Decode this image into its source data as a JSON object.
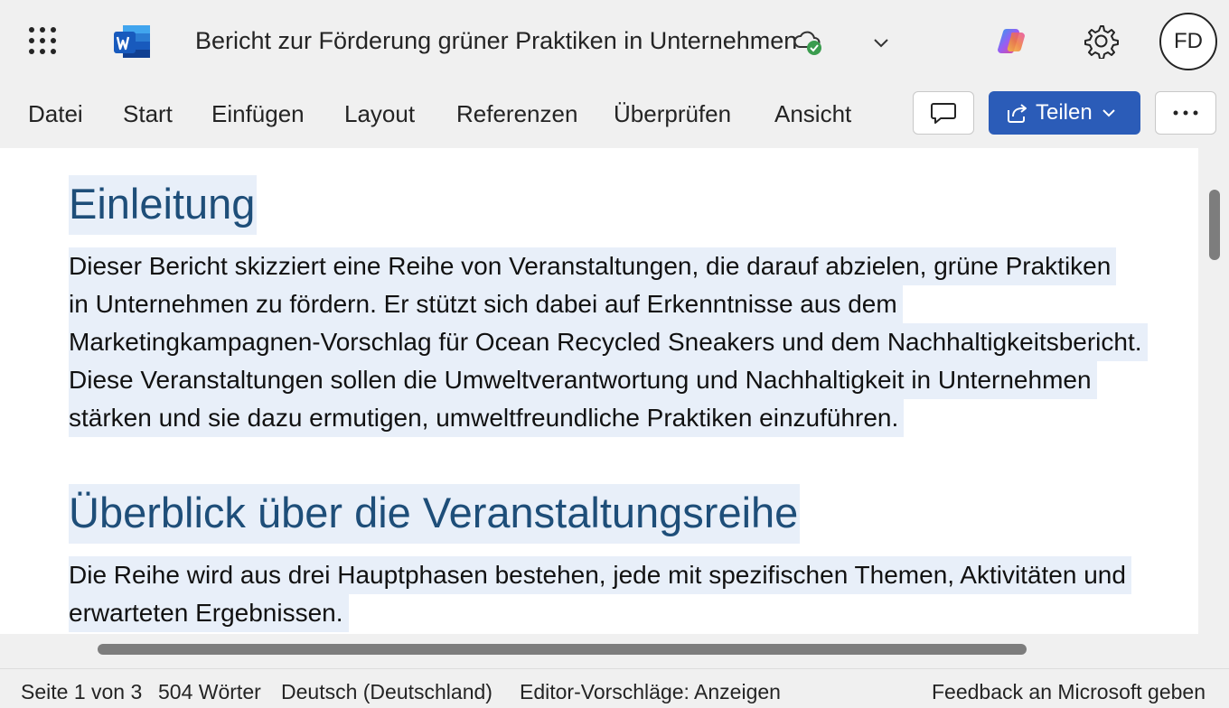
{
  "app": {
    "title": "Bericht zur Förderung grüner Praktiken in Unternehmen",
    "user_initials": "FD",
    "accent_color": "#2b5cb8",
    "icons": [
      "app-launcher-icon",
      "word-logo-icon",
      "cloud-saved-icon",
      "chevron-down-icon",
      "copilot-icon",
      "gear-icon"
    ]
  },
  "ribbon": {
    "tabs": [
      "Datei",
      "Start",
      "Einfügen",
      "Layout",
      "Referenzen",
      "Überprüfen",
      "Ansicht"
    ],
    "share_label": "Teilen",
    "comment_icon": "comment-icon",
    "more_icon": "more-icon"
  },
  "document": {
    "heading1": "Einleitung",
    "paragraph1_lines": [
      "Dieser Bericht skizziert eine Reihe von Veranstaltungen, die darauf abzielen, grüne Praktiken",
      "in Unternehmen zu fördern. Er stützt sich dabei auf Erkenntnisse aus dem",
      "Marketingkampagnen-Vorschlag für Ocean Recycled Sneakers und dem Nachhaltigkeitsbericht.",
      "Diese Veranstaltungen sollen die Umweltverantwortung und Nachhaltigkeit in Unternehmen",
      "stärken und sie dazu ermutigen, umweltfreundliche Praktiken einzuführen."
    ],
    "heading2": "Überblick über die Veranstaltungsreihe",
    "paragraph2_lines": [
      "Die Reihe wird aus drei Hauptphasen bestehen, jede mit spezifischen Themen, Aktivitäten und",
      "erwarteten Ergebnissen."
    ]
  },
  "statusbar": {
    "page": "Seite 1 von 3",
    "words": "504 Wörter",
    "language": "Deutsch (Deutschland)",
    "editor": "Editor-Vorschläge: Anzeigen",
    "feedback": "Feedback an Microsoft geben"
  }
}
